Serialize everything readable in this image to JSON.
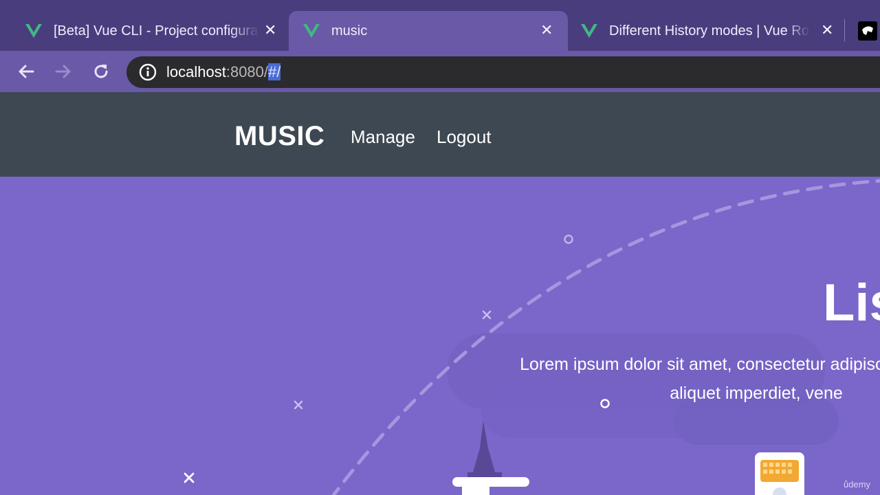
{
  "browser": {
    "tabs": [
      {
        "title": "[Beta] Vue CLI - Project configuration",
        "icon": "vue-logo-icon"
      },
      {
        "title": "music",
        "icon": "vue-logo-icon",
        "active": true
      },
      {
        "title": "Different History modes | Vue Router",
        "icon": "vue-logo-icon"
      }
    ],
    "url": {
      "host": "localhost",
      "port": ":8080/",
      "selected": "#/"
    }
  },
  "app": {
    "brand": "MUSIC",
    "nav": {
      "manage": "Manage",
      "logout": "Logout"
    }
  },
  "hero": {
    "title": "Lis",
    "text": "Lorem ipsum dolor sit amet, consectetur adipiscing elit. Donec aliquet imperdiet, vene"
  },
  "watermark": "ůdemy",
  "colors": {
    "tab_strip": "#4a3d7e",
    "active_tab": "#6a59a6",
    "app_header": "#3d4852",
    "hero_bg": "#7b66c9",
    "vue_green": "#41b883"
  }
}
